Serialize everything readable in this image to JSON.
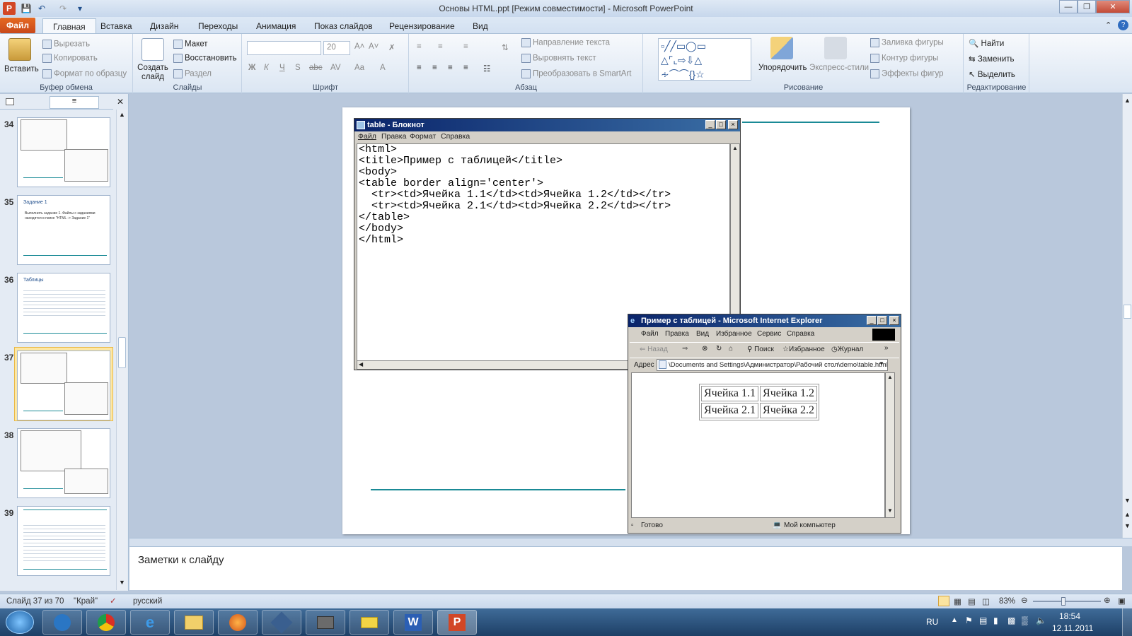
{
  "window": {
    "title": "Основы HTML.ppt [Режим совместимости]  -  Microsoft PowerPoint"
  },
  "ribbon_tabs": [
    "Файл",
    "Главная",
    "Вставка",
    "Дизайн",
    "Переходы",
    "Анимация",
    "Показ слайдов",
    "Рецензирование",
    "Вид"
  ],
  "clipboard": {
    "paste": "Вставить",
    "cut": "Вырезать",
    "copy": "Копировать",
    "format": "Формат по образцу",
    "label": "Буфер обмена"
  },
  "slides_group": {
    "create": "Создать слайд",
    "layout": "Макет",
    "reset": "Восстановить",
    "section": "Раздел",
    "label": "Слайды"
  },
  "font_group": {
    "size": "20",
    "label": "Шрифт"
  },
  "paragraph_group": {
    "text_direction": "Направление текста",
    "align_text": "Выровнять текст",
    "smartart": "Преобразовать в SmartArt",
    "label": "Абзац"
  },
  "drawing_group": {
    "arrange": "Упорядочить",
    "quick_styles": "Экспресс-стили",
    "fill": "Заливка фигуры",
    "outline": "Контур фигуры",
    "effects": "Эффекты фигур",
    "label": "Рисование"
  },
  "editing_group": {
    "find": "Найти",
    "replace": "Заменить",
    "select": "Выделить",
    "label": "Редактирование"
  },
  "thumbnails": [
    {
      "num": "34",
      "title": ""
    },
    {
      "num": "35",
      "title": "Задание 1",
      "text": "Выполнить задание 1. Файлы с заданиями находятся в папке \"HTML -> Задание 1\""
    },
    {
      "num": "36",
      "title": "Таблицы"
    },
    {
      "num": "37",
      "title": ""
    },
    {
      "num": "38",
      "title": ""
    },
    {
      "num": "39",
      "title": ""
    }
  ],
  "notepad": {
    "title": "table - Блокнот",
    "menu": [
      "Файл",
      "Правка",
      "Формат",
      "Справка"
    ],
    "lines": [
      "<html>",
      "<title>Пример с таблицей</title>",
      "<body>",
      "<table border align='center'>",
      "  <tr><td>Ячейка 1.1</td><td>Ячейка 1.2</td></tr>",
      "  <tr><td>Ячейка 2.1</td><td>Ячейка 2.2</td></tr>",
      "</table>",
      "</body>",
      "</html>"
    ]
  },
  "ie": {
    "title": "Пример с таблицей - Microsoft Internet Explorer",
    "menu": [
      "Файл",
      "Правка",
      "Вид",
      "Избранное",
      "Сервис",
      "Справка"
    ],
    "back": "Назад",
    "search": "Поиск",
    "favorites": "Избранное",
    "journal": "Журнал",
    "address_label": "Адрес",
    "address": "\\Documents and Settings\\Администратор\\Рабочий стол\\demo\\table.html",
    "table": [
      [
        "Ячейка 1.1",
        "Ячейка 1.2"
      ],
      [
        "Ячейка 2.1",
        "Ячейка 2.2"
      ]
    ],
    "status_ready": "Готово",
    "status_zone": "Мой компьютер"
  },
  "notes": {
    "placeholder": "Заметки к слайду"
  },
  "status": {
    "slide": "Слайд 37 из 70",
    "theme": "\"Край\"",
    "language": "русский",
    "zoom": "83%"
  },
  "tray": {
    "lang": "RU",
    "time": "18:54",
    "date": "12.11.2011"
  },
  "colors": {
    "accent_line": "#1a8a96",
    "office_orange": "#d55a1e",
    "selected_thumb": "#fde7a4"
  }
}
